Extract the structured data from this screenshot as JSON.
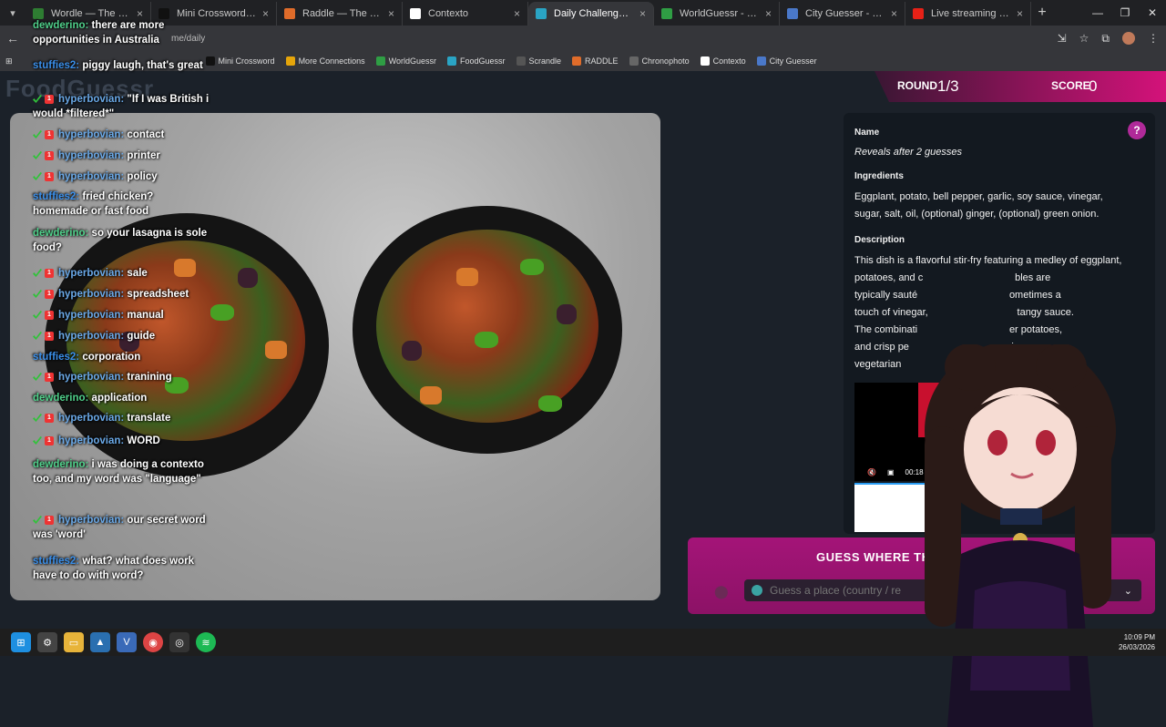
{
  "browser": {
    "tabs": [
      {
        "label": "Wordle — The New York",
        "color": "#2e7d32"
      },
      {
        "label": "Mini Crossword - Los Ang",
        "color": "#111111"
      },
      {
        "label": "Raddle — The Word Tran",
        "color": "#e06c2a"
      },
      {
        "label": "Contexto",
        "color": "#ffffff"
      },
      {
        "label": "Daily Challenge - FoodGu",
        "color": "#2aa4c4",
        "active": true
      },
      {
        "label": "WorldGuessr - Play Geog",
        "color": "#2f9e44"
      },
      {
        "label": "City Guesser - Can you gu",
        "color": "#4a78c9"
      },
      {
        "label": "Live streaming - YouTube",
        "color": "#e62117"
      }
    ],
    "url": "me/daily",
    "bookmarks": [
      "Mini Crossword",
      "More Connections",
      "WorldGuessr",
      "FoodGuessr",
      "Scrandle",
      "RADDLE",
      "Chronophoto",
      "Contexto",
      "City Guesser"
    ]
  },
  "game": {
    "logo": "FoodGuessr",
    "round_label": "ROUND",
    "round_value": "1/3",
    "score_label": "SCORE",
    "score_value": "0",
    "name_heading": "Name",
    "name_value": "Reveals after 2 guesses",
    "ingredients_heading": "Ingredients",
    "ingredients_value": "Eggplant, potato, bell pepper, garlic, soy sauce, vinegar, sugar, salt, oil, (optional) ginger, (optional) green onion.",
    "description_heading": "Description",
    "description_lines": [
      "This dish is a flavorful stir-fry featuring a medley of eggplant,",
      "potatoes, and c                                 bles are",
      "typically sauté                                 ometimes a",
      "touch of vinegar,                                tangy sauce.",
      "The combinati                                 er potatoes,",
      "and crisp pe                                   cious",
      "vegetarian"
    ],
    "video_time": "00:18",
    "guess_title": "GUESS WHERE TH",
    "guess_placeholder": "Guess a place (country / re"
  },
  "chat": [
    {
      "user": "dewderino:",
      "text": "there are more opportunities in Australia",
      "ucls": "u-dew",
      "badge": false
    },
    {
      "user": "stuffies2:",
      "text": "piggy laugh, that's great",
      "ucls": "u-stuff",
      "badge": false
    },
    {
      "user": "hyperbovian:",
      "text": "\"If I was British i would *filtered*\"",
      "ucls": "u-hyper",
      "badge": true
    },
    {
      "user": "hyperbovian:",
      "text": "contact",
      "ucls": "u-hyper",
      "badge": true
    },
    {
      "user": "hyperbovian:",
      "text": "printer",
      "ucls": "u-hyper",
      "badge": true
    },
    {
      "user": "hyperbovian:",
      "text": "policy",
      "ucls": "u-hyper",
      "badge": true
    },
    {
      "user": "stuffies2:",
      "text": "fried chicken? homemade or fast food",
      "ucls": "u-stuff",
      "badge": false
    },
    {
      "user": "dewderino:",
      "text": "so your lasagna is sole food?",
      "ucls": "u-dew",
      "badge": false
    },
    {
      "user": "hyperbovian:",
      "text": "sale",
      "ucls": "u-hyper",
      "badge": true
    },
    {
      "user": "hyperbovian:",
      "text": "spreadsheet",
      "ucls": "u-hyper",
      "badge": true
    },
    {
      "user": "hyperbovian:",
      "text": "manual",
      "ucls": "u-hyper",
      "badge": true
    },
    {
      "user": "hyperbovian:",
      "text": "guide",
      "ucls": "u-hyper",
      "badge": true
    },
    {
      "user": "stuffies2:",
      "text": "corporation",
      "ucls": "u-stuff",
      "badge": false
    },
    {
      "user": "hyperbovian:",
      "text": "tranining",
      "ucls": "u-hyper",
      "badge": true
    },
    {
      "user": "dewderino:",
      "text": "application",
      "ucls": "u-dew",
      "badge": false
    },
    {
      "user": "hyperbovian:",
      "text": "translate",
      "ucls": "u-hyper",
      "badge": true
    },
    {
      "user": "hyperbovian:",
      "text": "WORD",
      "ucls": "u-hyper",
      "badge": true
    },
    {
      "user": "dewderino:",
      "text": "i was doing a contexto too, and my word was \"language\"",
      "ucls": "u-dew",
      "badge": false
    },
    {
      "user": "hyperbovian:",
      "text": "our secret word was 'word'",
      "ucls": "u-hyper",
      "badge": true
    },
    {
      "user": "stuffies2:",
      "text": "what? what does work have to do with word?",
      "ucls": "u-stuff",
      "badge": false
    }
  ],
  "taskbar": {
    "time": "10:09 PM",
    "date": "26/03/2026"
  }
}
